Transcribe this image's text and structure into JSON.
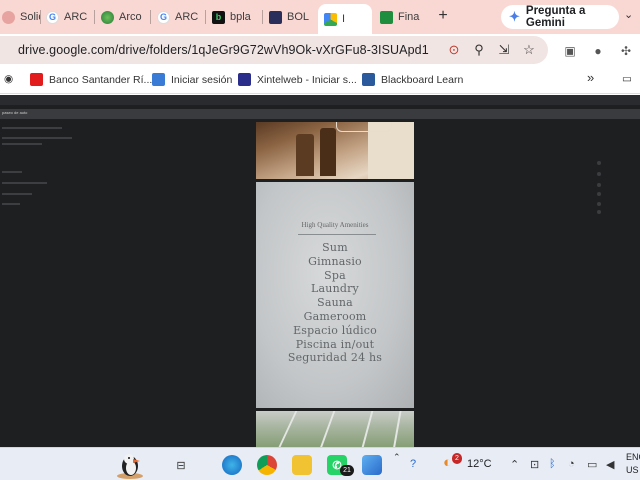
{
  "browser": {
    "tabs": [
      {
        "label": "Solic",
        "icon": "pink-favicon"
      },
      {
        "label": "ARC",
        "icon": "google-icon"
      },
      {
        "label": "Arco",
        "icon": "globe-icon"
      },
      {
        "label": "ARC",
        "icon": "google-icon"
      },
      {
        "label": "bpla",
        "icon": "b-logo-icon"
      },
      {
        "label": "BOL",
        "icon": "shield-favicon"
      },
      {
        "label": "I",
        "icon": "google-drive-icon",
        "active": true
      },
      {
        "label": "Fina",
        "icon": "sheets-icon"
      }
    ],
    "new_tab": "+",
    "gemini_button": "Pregunta a Gemini",
    "address": "drive.google.com/drive/folders/1qJeGr9G72wVh9Ok-vXrGFu8-3ISUApd1",
    "bookmarks": [
      {
        "label": "Banco Santander Rí...",
        "color": "#e21c1c"
      },
      {
        "label": "Iniciar sesión",
        "color": "#3a7bd5"
      },
      {
        "label": "Xintelweb - Iniciar s...",
        "color": "#2a2e8a"
      },
      {
        "label": "Blackboard Learn",
        "color": "#2a5a9c"
      }
    ],
    "bookmarks_more": "»"
  },
  "viewer": {
    "title": "paseo de auto",
    "amenities_title": "High Quality Amenities",
    "amenities": [
      "Sum",
      "Gimnasio",
      "Spa",
      "Laundry",
      "Sauna",
      "Gameroom",
      "Espacio lúdico",
      "Piscina in/out",
      "Seguridad 24 hs"
    ]
  },
  "taskbar": {
    "whatsapp_badge": "21",
    "weather_badge": "2",
    "temperature": "12°C",
    "lang_top": "ENG",
    "lang_bottom": "US"
  }
}
